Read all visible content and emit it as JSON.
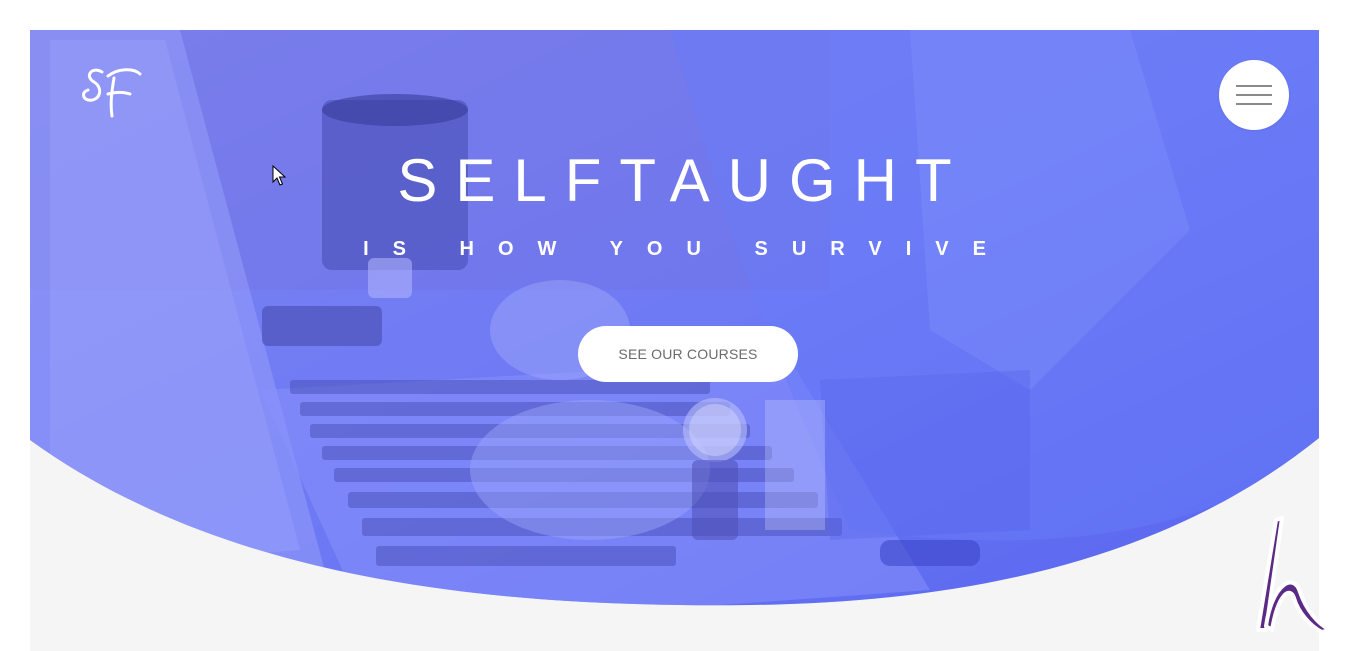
{
  "header": {
    "logo_text": "SF",
    "menu_icon": "hamburger-icon"
  },
  "hero": {
    "title": "SELFTAUGHT",
    "subtitle": "IS HOW YOU SURVIVE",
    "cta_label": "SEE OUR COURSES"
  },
  "overlay": {
    "brand_mark": "h",
    "brand_color": "#5b2a86"
  },
  "colors": {
    "hero_overlay": "#6b78f0",
    "page_background": "#f5f5f5",
    "button_text": "#6b6b6b"
  }
}
